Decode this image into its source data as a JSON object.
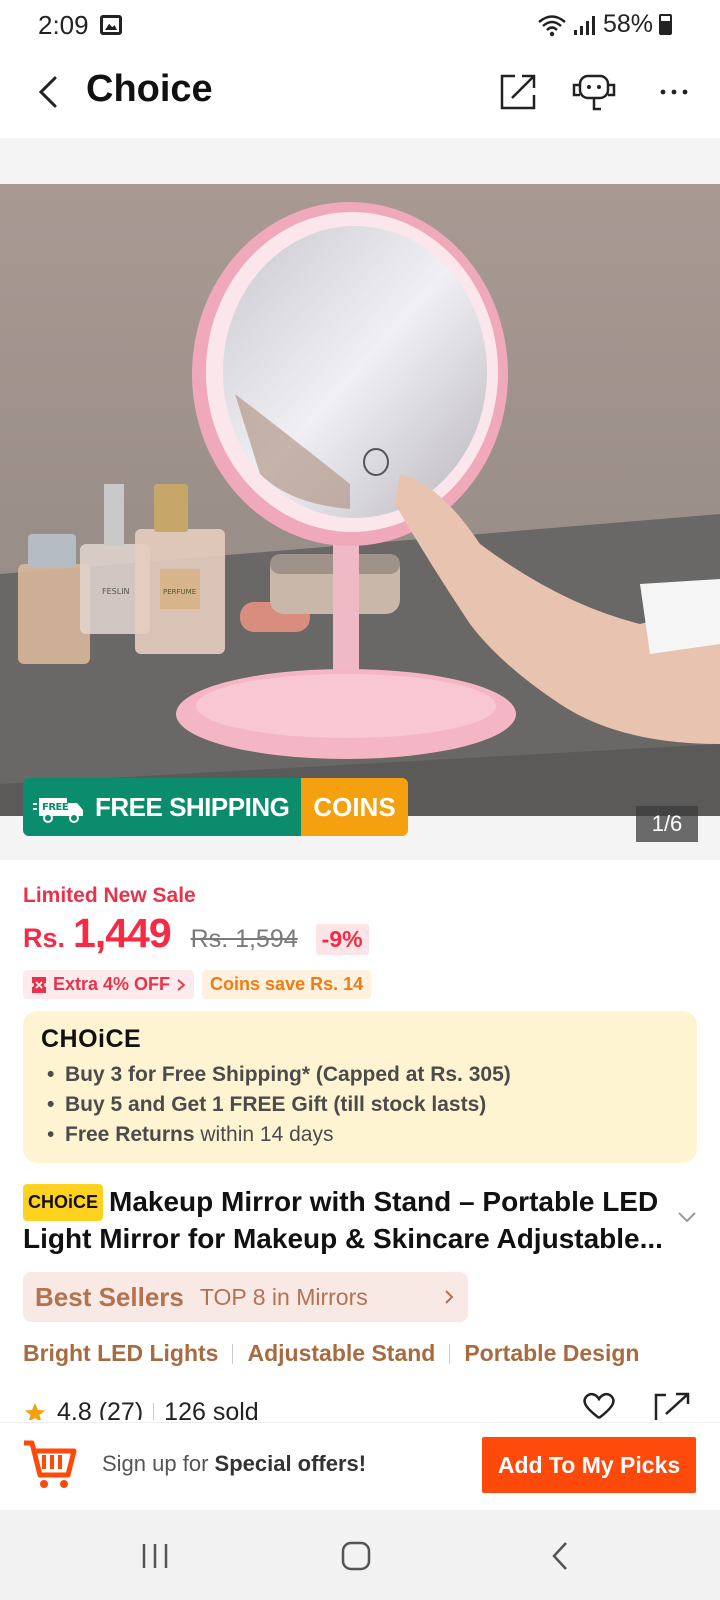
{
  "status": {
    "time": "2:09",
    "battery": "58%"
  },
  "header": {
    "title": "Choice"
  },
  "image": {
    "counter": "1/6",
    "badge_free_small": "FREE",
    "badge_free": "FREE SHIPPING",
    "badge_coins": "COINS",
    "perfume_label": "PERFUME",
    "perfume_brand": "FESLIN"
  },
  "price": {
    "sale_label": "Limited New Sale",
    "currency": "Rs.",
    "current": "1,449",
    "original": "Rs. 1,594",
    "discount": "-9%",
    "extra_off": "Extra 4% OFF",
    "coins_save": "Coins save Rs. 14"
  },
  "choice": {
    "logo": "CHOiCE",
    "line1": "Buy 3 for  Free Shipping* (Capped at Rs. 305)",
    "line2": "Buy 5 and Get 1 FREE Gift (till stock lasts)",
    "line3_bold": "Free Returns",
    "line3_rest": " within 14 days"
  },
  "product": {
    "badge": "CHOiCE",
    "title": "Makeup Mirror with Stand – Portable LED Light Mirror for Makeup & Skincare Adjustable..."
  },
  "best": {
    "title": "Best Sellers",
    "rank": "TOP 8 in Mirrors"
  },
  "features": [
    "Bright LED Lights",
    "Adjustable Stand",
    "Portable Design"
  ],
  "rating": {
    "score": "4.8 (27)",
    "sold": "126 sold"
  },
  "bottom": {
    "signup_prefix": "Sign up for ",
    "signup_bold": "Special offers!",
    "cta": "Add To My Picks"
  },
  "colors": {
    "accent": "#fd4a0b",
    "price": "#f52b46",
    "shipping": "#0a8c6d",
    "coins": "#f5a10f",
    "choice_bg": "#fff4d2"
  }
}
